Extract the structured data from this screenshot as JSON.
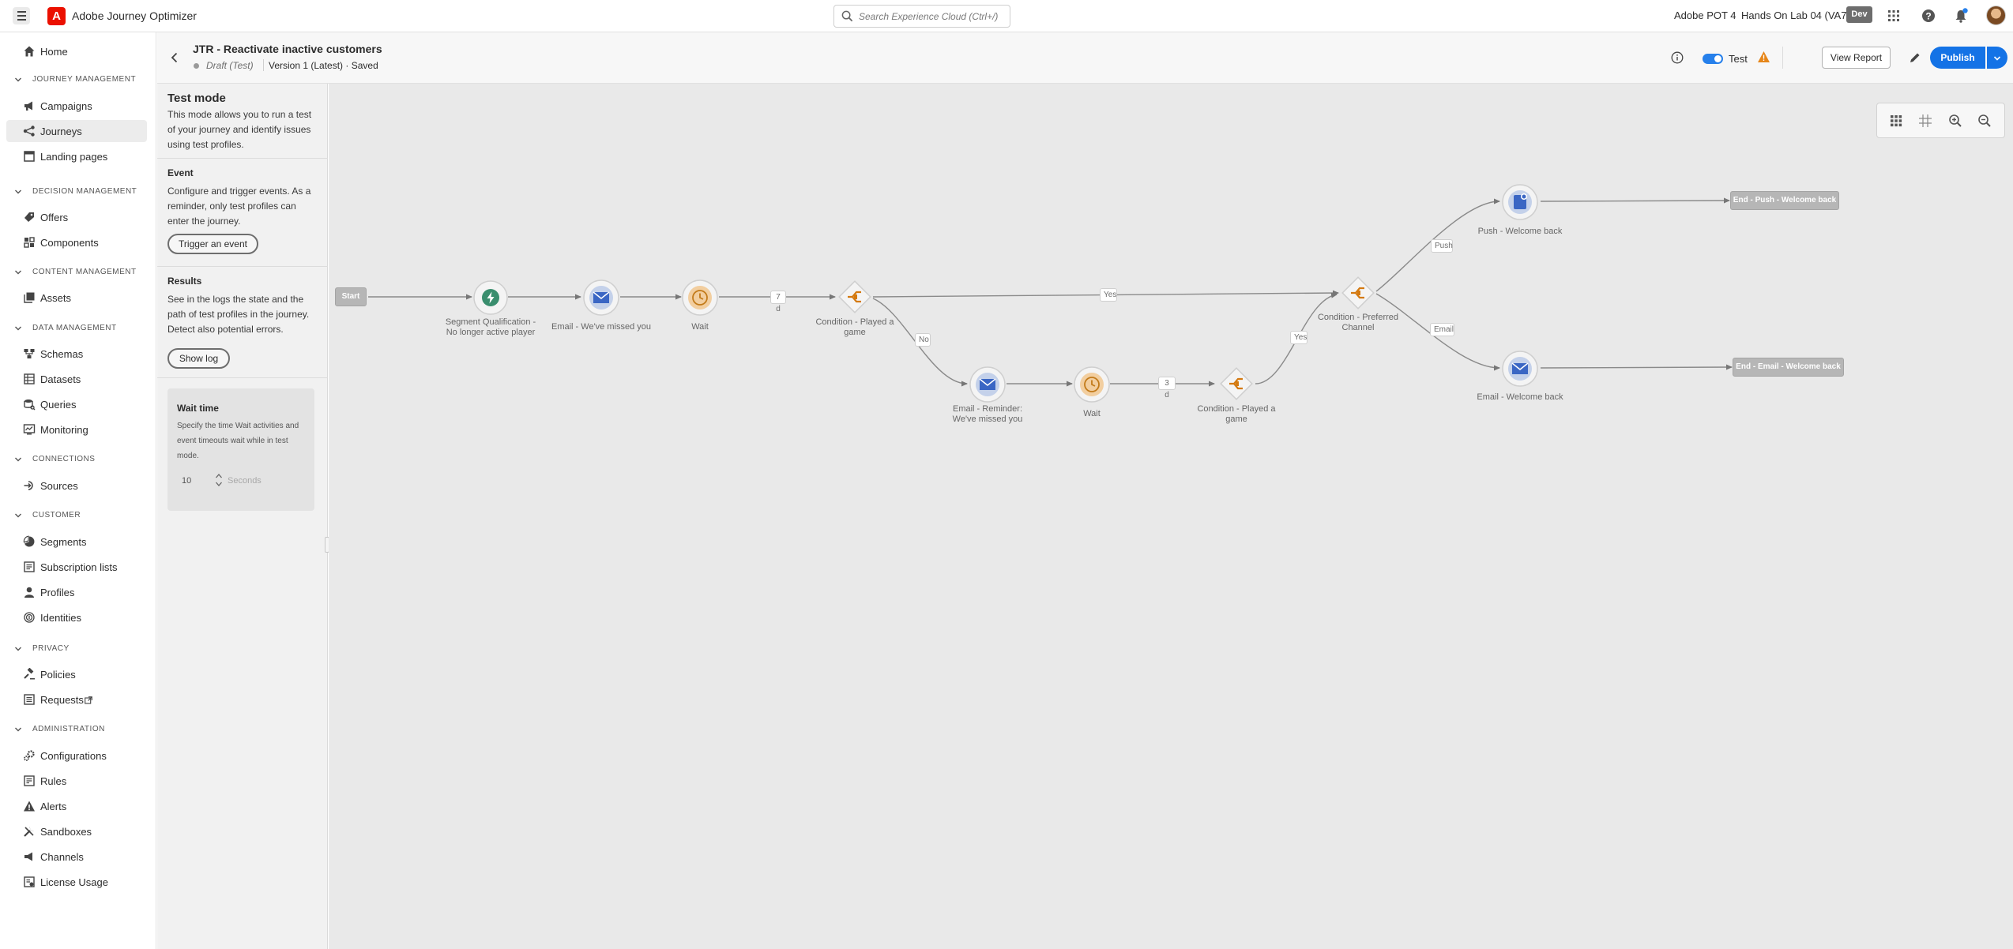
{
  "topbar": {
    "app_title": "Adobe Journey Optimizer",
    "search_placeholder": "Search Experience Cloud (Ctrl+/)",
    "org": "Adobe POT 4",
    "sandbox": "Hands On Lab 04 (VA7)",
    "env_badge": "Dev"
  },
  "sidebar": {
    "home": "Home",
    "sections": {
      "journey_management": "JOURNEY MANAGEMENT",
      "decision_management": "DECISION MANAGEMENT",
      "content_management": "CONTENT MANAGEMENT",
      "data_management": "DATA MANAGEMENT",
      "connections": "CONNECTIONS",
      "customer": "CUSTOMER",
      "privacy": "PRIVACY",
      "administration": "ADMINISTRATION"
    },
    "items": {
      "campaigns": "Campaigns",
      "journeys": "Journeys",
      "landing_pages": "Landing pages",
      "offers": "Offers",
      "components": "Components",
      "assets": "Assets",
      "schemas": "Schemas",
      "datasets": "Datasets",
      "queries": "Queries",
      "monitoring": "Monitoring",
      "sources": "Sources",
      "segments": "Segments",
      "subscription_lists": "Subscription lists",
      "profiles": "Profiles",
      "identities": "Identities",
      "policies": "Policies",
      "requests": "Requests",
      "configurations": "Configurations",
      "rules": "Rules",
      "alerts": "Alerts",
      "sandboxes": "Sandboxes",
      "channels": "Channels",
      "license_usage": "License Usage"
    }
  },
  "journey": {
    "title": "JTR - Reactivate inactive customers",
    "status": "Draft (Test)",
    "version": "Version 1 (Latest) · Saved",
    "test_label": "Test",
    "test_enabled": true,
    "view_report": "View Report",
    "publish": "Publish"
  },
  "test_panel": {
    "title": "Test mode",
    "intro": "This mode allows you to run a test of your journey and identify issues using test profiles.",
    "event_title": "Event",
    "event_text": "Configure and trigger events. As a reminder, only test profiles can enter the journey.",
    "trigger_button": "Trigger an event",
    "results_title": "Results",
    "results_text": "See in the logs the state and the path of test profiles in the journey. Detect also potential errors.",
    "show_log_button": "Show log",
    "wait_title": "Wait time",
    "wait_text": "Specify the time Wait activities and event timeouts wait while in test mode.",
    "wait_value": "10",
    "wait_unit": "Seconds"
  },
  "canvas": {
    "start": "Start",
    "nodes": {
      "segment": "Segment Qualification - No longer active player",
      "email_missed": "Email - We've missed you",
      "wait1": "Wait",
      "condition_played1": "Condition - Played a game",
      "email_reminder": "Email - Reminder: We've missed you",
      "wait2": "Wait",
      "condition_played2": "Condition - Played a game",
      "condition_channel": "Condition - Preferred Channel",
      "push_welcome": "Push - Welcome back",
      "email_welcome": "Email - Welcome back"
    },
    "edges": {
      "wait1_duration": "7 d",
      "yes_top": "Yes",
      "no": "No",
      "wait2_duration": "3 d",
      "yes_bottom": "Yes",
      "push": "Push",
      "email": "Email"
    },
    "ends": {
      "push": "End - Push - Welcome back",
      "email": "End - Email - Welcome back"
    }
  }
}
